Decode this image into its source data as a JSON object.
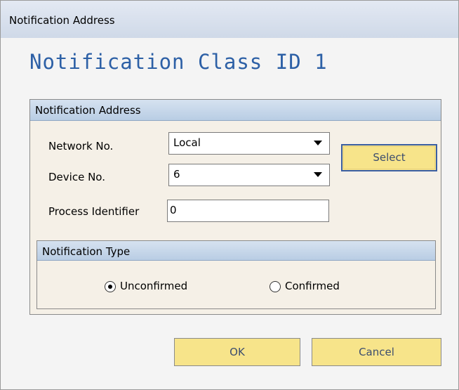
{
  "window": {
    "title": "Notification Address"
  },
  "heading": "Notification Class ID 1",
  "address_group": {
    "title": "Notification Address",
    "network": {
      "label": "Network No.",
      "value": "Local"
    },
    "device": {
      "label": "Device No.",
      "value": "6"
    },
    "process": {
      "label": "Process Identifier",
      "value": "0"
    },
    "select_label": "Select"
  },
  "type_group": {
    "title": "Notification Type",
    "options": [
      {
        "label": "Unconfirmed",
        "selected": true
      },
      {
        "label": "Confirmed",
        "selected": false
      }
    ]
  },
  "buttons": {
    "ok": "OK",
    "cancel": "Cancel"
  },
  "colors": {
    "heading": "#2d60a6",
    "button": "#f7e48a",
    "panel": "#f5f0e7",
    "group_header": "#c6d6ea"
  },
  "icons": [
    "dropdown-arrow-icon",
    "radio-selected-icon",
    "radio-unselected-icon"
  ]
}
